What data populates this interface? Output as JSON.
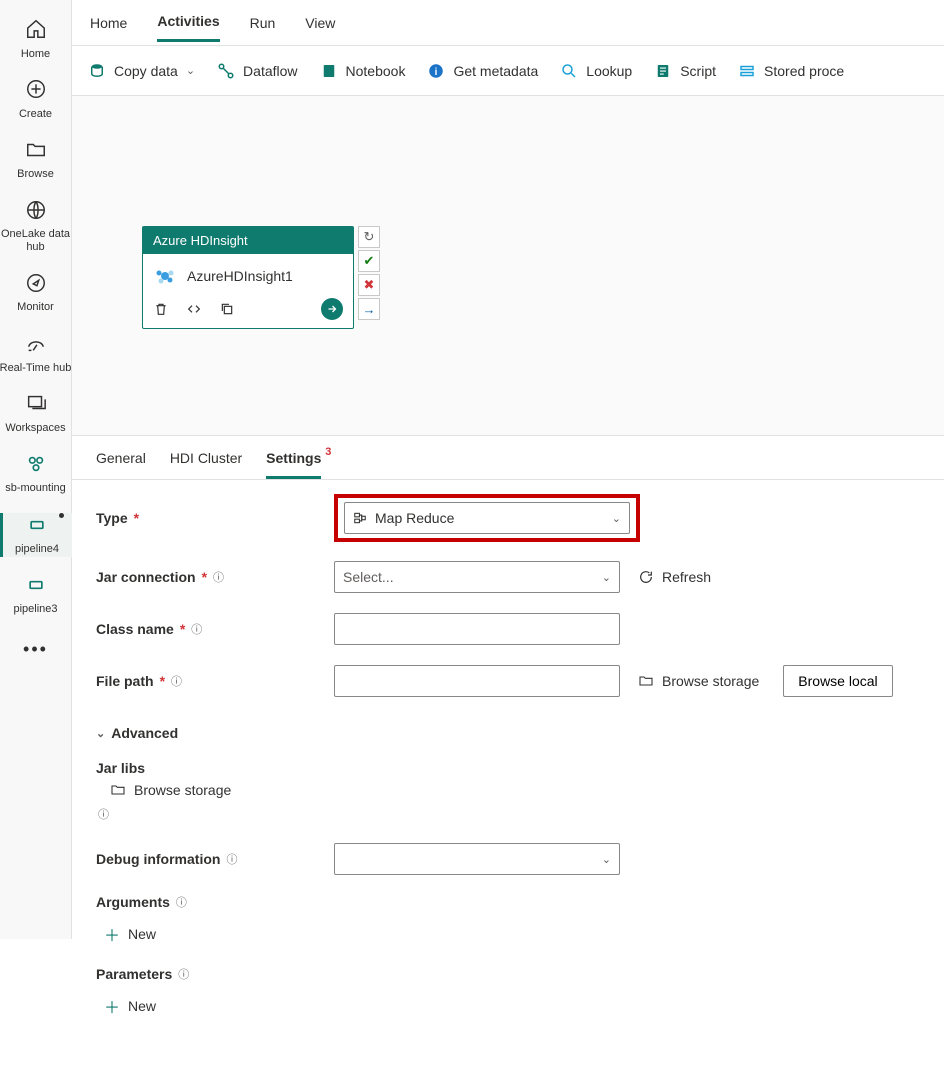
{
  "nav": {
    "items": [
      {
        "label": "Home"
      },
      {
        "label": "Create"
      },
      {
        "label": "Browse"
      },
      {
        "label": "OneLake data hub"
      },
      {
        "label": "Monitor"
      },
      {
        "label": "Real-Time hub"
      },
      {
        "label": "Workspaces"
      },
      {
        "label": "sb-mounting"
      },
      {
        "label": "pipeline4"
      },
      {
        "label": "pipeline3"
      }
    ]
  },
  "top_tabs": {
    "home": "Home",
    "activities": "Activities",
    "run": "Run",
    "view": "View"
  },
  "toolbar": {
    "copy_data": "Copy data",
    "dataflow": "Dataflow",
    "notebook": "Notebook",
    "get_metadata": "Get metadata",
    "lookup": "Lookup",
    "script": "Script",
    "stored_proc": "Stored proce"
  },
  "activity": {
    "header": "Azure HDInsight",
    "name": "AzureHDInsight1"
  },
  "settings_tabs": {
    "general": "General",
    "hdi_cluster": "HDI Cluster",
    "settings": "Settings",
    "settings_badge": "3"
  },
  "form": {
    "type_label": "Type",
    "type_value": "Map Reduce",
    "jar_connection_label": "Jar connection",
    "jar_connection_placeholder": "Select...",
    "refresh": "Refresh",
    "class_name_label": "Class name",
    "class_name_value": "",
    "file_path_label": "File path",
    "file_path_value": "",
    "browse_storage": "Browse storage",
    "browse_local": "Browse local",
    "advanced": "Advanced",
    "jar_libs_label": "Jar libs",
    "debug_info_label": "Debug information",
    "debug_info_value": "",
    "arguments_label": "Arguments",
    "parameters_label": "Parameters",
    "new": "New"
  }
}
